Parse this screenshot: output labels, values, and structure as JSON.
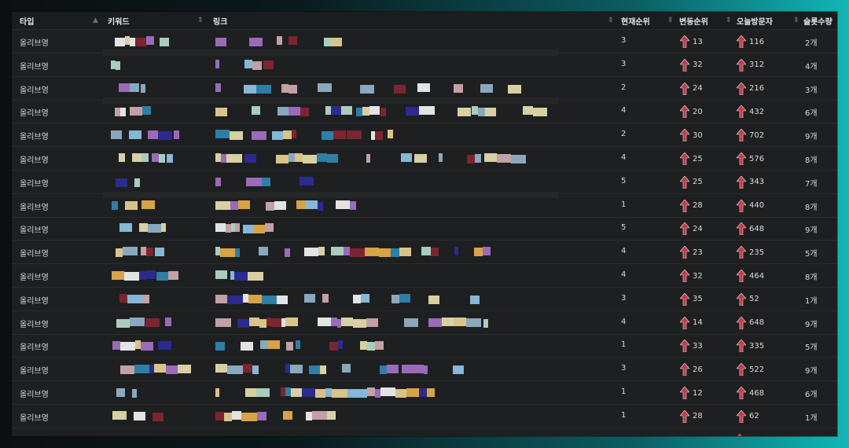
{
  "header": {
    "type_col": "타입",
    "keyword_col": "키워드",
    "link_col": "링크",
    "rank_col": "현재순위",
    "change_col": "변동순위",
    "visitors_col": "오늘방문자",
    "slots_col": "슬롯수량"
  },
  "icons": {
    "sort": "sort-arrows-icon",
    "change": "red-up-arrow-icon"
  },
  "colors": {
    "up_arrow": "#c33a48",
    "header_bg": "#1b1c1e",
    "table_bg": "#1e1f21"
  },
  "rows": [
    {
      "type": "올리브영",
      "rank": "3",
      "change": "13",
      "visitors": "116",
      "slots": "2개"
    },
    {
      "type": "올리브영",
      "rank": "3",
      "change": "32",
      "visitors": "312",
      "slots": "4개"
    },
    {
      "type": "올리브영",
      "rank": "2",
      "change": "24",
      "visitors": "216",
      "slots": "3개"
    },
    {
      "type": "올리브영",
      "rank": "4",
      "change": "20",
      "visitors": "432",
      "slots": "6개"
    },
    {
      "type": "올리브영",
      "rank": "2",
      "change": "30",
      "visitors": "702",
      "slots": "9개"
    },
    {
      "type": "올리브영",
      "rank": "4",
      "change": "25",
      "visitors": "576",
      "slots": "8개"
    },
    {
      "type": "올리브영",
      "rank": "5",
      "change": "25",
      "visitors": "343",
      "slots": "7개"
    },
    {
      "type": "올리브영",
      "rank": "1",
      "change": "28",
      "visitors": "440",
      "slots": "8개"
    },
    {
      "type": "올리브영",
      "rank": "5",
      "change": "24",
      "visitors": "648",
      "slots": "9개"
    },
    {
      "type": "올리브영",
      "rank": "4",
      "change": "23",
      "visitors": "235",
      "slots": "5개"
    },
    {
      "type": "올리브영",
      "rank": "4",
      "change": "32",
      "visitors": "464",
      "slots": "8개"
    },
    {
      "type": "올리브영",
      "rank": "3",
      "change": "35",
      "visitors": "52",
      "slots": "1개"
    },
    {
      "type": "올리브영",
      "rank": "4",
      "change": "14",
      "visitors": "648",
      "slots": "9개"
    },
    {
      "type": "올리브영",
      "rank": "1",
      "change": "33",
      "visitors": "335",
      "slots": "5개"
    },
    {
      "type": "올리브영",
      "rank": "3",
      "change": "26",
      "visitors": "522",
      "slots": "9개"
    },
    {
      "type": "올리브영",
      "rank": "1",
      "change": "12",
      "visitors": "468",
      "slots": "6개"
    },
    {
      "type": "올리브영",
      "rank": "1",
      "change": "28",
      "visitors": "62",
      "slots": "1개"
    }
  ]
}
